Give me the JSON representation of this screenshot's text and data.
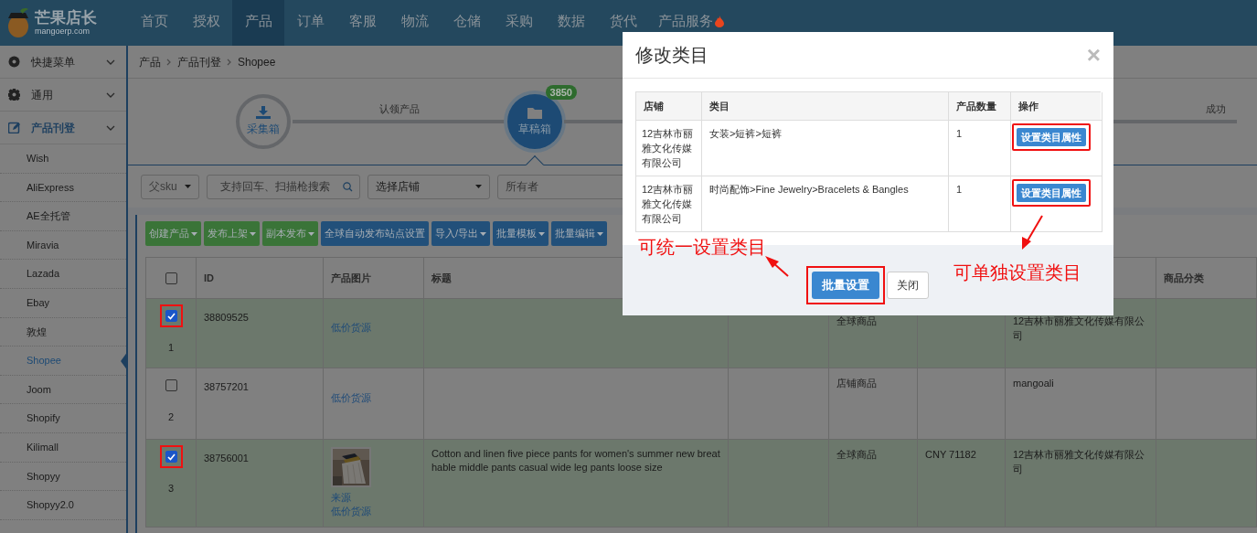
{
  "logo": {
    "title": "芒果店长",
    "subtitle": "mangoerp.com"
  },
  "nav": [
    {
      "label": "首页",
      "selected": false
    },
    {
      "label": "授权",
      "selected": false
    },
    {
      "label": "产品",
      "selected": true
    },
    {
      "label": "订单",
      "selected": false
    },
    {
      "label": "客服",
      "selected": false
    },
    {
      "label": "物流",
      "selected": false
    },
    {
      "label": "仓储",
      "selected": false
    },
    {
      "label": "采购",
      "selected": false
    },
    {
      "label": "数据",
      "selected": false
    },
    {
      "label": "货代",
      "selected": false
    },
    {
      "label": "产品服务",
      "selected": false,
      "hot": true
    }
  ],
  "sidebar": {
    "groups": [
      {
        "label": "快捷菜单",
        "kind": "disc",
        "expanded": false
      },
      {
        "label": "通用",
        "kind": "gear",
        "expanded": false
      },
      {
        "label": "产品刊登",
        "kind": "edit",
        "expanded": true,
        "children": [
          {
            "label": "Wish",
            "selected": false
          },
          {
            "label": "AliExpress",
            "selected": false
          },
          {
            "label": "AE全托管",
            "selected": false
          },
          {
            "label": "Miravia",
            "selected": false
          },
          {
            "label": "Lazada",
            "selected": false
          },
          {
            "label": "Ebay",
            "selected": false
          },
          {
            "label": "敦煌",
            "selected": false
          },
          {
            "label": "Shopee",
            "selected": true
          },
          {
            "label": "Joom",
            "selected": false
          },
          {
            "label": "Shopify",
            "selected": false
          },
          {
            "label": "Kilimall",
            "selected": false
          },
          {
            "label": "Shopyy",
            "selected": false
          },
          {
            "label": "Shopyy2.0",
            "selected": false
          }
        ]
      }
    ]
  },
  "breadcrumb": [
    "产品",
    "产品刊登",
    "Shopee"
  ],
  "steps": [
    {
      "label": "采集箱",
      "kind": "download",
      "selected": false
    },
    {
      "label": "草稿箱",
      "kind": "folder",
      "selected": true,
      "badge": "3850"
    }
  ],
  "step_links": [
    "认领产品"
  ],
  "steps_end": "成功",
  "filters": [
    {
      "kind": "select",
      "value": "父sku"
    },
    {
      "kind": "search",
      "placeholder": "支持回车、扫描枪搜索"
    },
    {
      "kind": "select",
      "value": "选择店铺"
    },
    {
      "kind": "input",
      "placeholder": "所有者"
    }
  ],
  "toolbar": [
    {
      "label": "创建产品",
      "color": "#3a7438",
      "dropdown": true
    },
    {
      "label": "发布上架",
      "color": "#3a7438",
      "dropdown": true
    },
    {
      "label": "副本发布",
      "color": "#3a7438",
      "dropdown": true
    },
    {
      "label": "全球自动发布站点设置",
      "color": "#22507a",
      "dropdown": false
    },
    {
      "label": "导入/导出",
      "color": "#22507a",
      "dropdown": true
    },
    {
      "label": "批量模板",
      "color": "#22507a",
      "dropdown": true
    },
    {
      "label": "批量编辑",
      "color": "#22507a",
      "dropdown": true
    }
  ],
  "table": {
    "header_checked": false,
    "columns": [
      {
        "label": "ID"
      },
      {
        "label": "产品图片"
      },
      {
        "label": "标题"
      },
      {
        "kind": "covered"
      },
      {
        "kind": "covered"
      },
      {
        "kind": "covered"
      },
      {
        "kind": "covered"
      },
      {
        "label": "商品分类"
      }
    ],
    "rows": [
      {
        "checked": true,
        "highlighted": true,
        "number": "1",
        "id": "38809525",
        "links": [
          "低价货源"
        ],
        "column_6": "全球商品",
        "column_8": "12吉林市丽雅文化传媒有限公司"
      },
      {
        "checked": false,
        "highlighted": false,
        "number": "2",
        "id": "38757201",
        "links": [
          "低价货源"
        ],
        "column_6": "店铺商品",
        "column_8": "mangoali"
      },
      {
        "checked": true,
        "highlighted": true,
        "number": "3",
        "id": "38756001",
        "image": {
          "kind": "picture"
        },
        "links": [
          "来源",
          "低价货源"
        ],
        "title": "Cotton and linen five piece pants for women's summer new breathable middle pants casual wide leg pants loose size",
        "column_6": "全球商品",
        "column_7": "CNY 71182",
        "column_8": "12吉林市丽雅文化传媒有限公司"
      }
    ]
  },
  "modal": {
    "title": "修改类目",
    "close": "×",
    "columns": [
      "店铺",
      "类目",
      "产品数量",
      "操作"
    ],
    "rows": [
      {
        "store": "12吉林市丽雅文化传媒有限公司",
        "category": "女装>短裤>短裤",
        "count": "1",
        "action": "设置类目属性",
        "highlighted": true
      },
      {
        "store": "12吉林市丽雅文化传媒有限公司",
        "category": "时尚配饰>Fine Jewelry>Bracelets & Bangles",
        "count": "1",
        "action": "设置类目属性",
        "highlighted": true
      }
    ],
    "buttons": [
      {
        "label": "批量设置",
        "kind": "primary",
        "highlighted": true
      },
      {
        "label": "关闭",
        "kind": "default",
        "highlighted": false
      }
    ]
  },
  "annotations": [
    {
      "text": "可统一设置类目"
    },
    {
      "text": "可单独设置类目"
    }
  ]
}
